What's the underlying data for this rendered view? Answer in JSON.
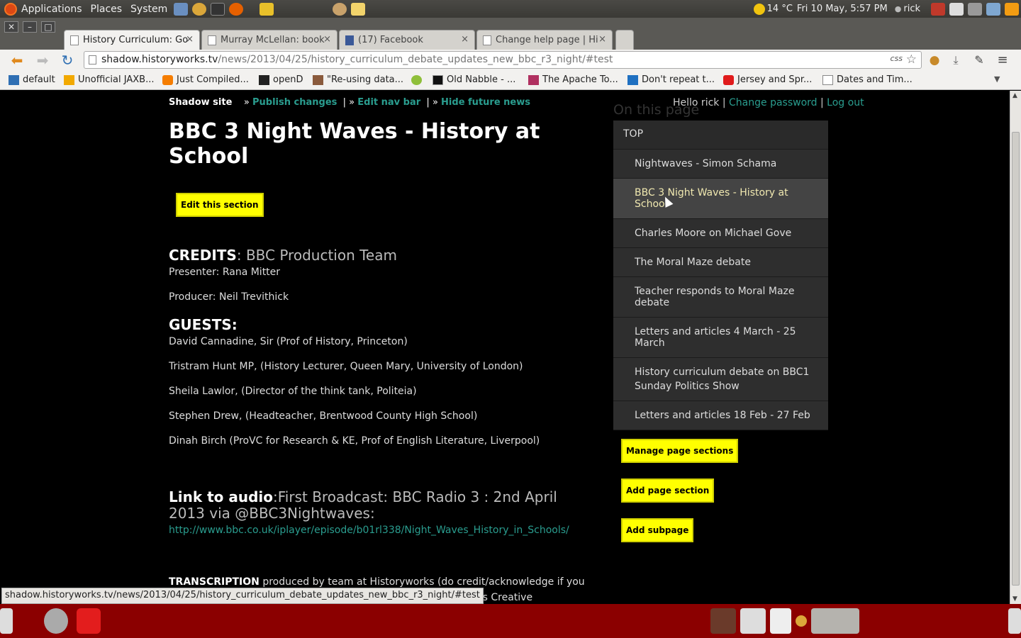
{
  "top_panel": {
    "menus": [
      "Applications",
      "Places",
      "System"
    ],
    "weather": "14 °C",
    "clock": "Fri 10 May,  5:57 PM",
    "user": "rick"
  },
  "tabs": [
    {
      "label": "History Curriculum: Go",
      "active": true
    },
    {
      "label": "Murray McLellan: book",
      "active": false
    },
    {
      "label": "(17) Facebook",
      "active": false
    },
    {
      "label": "Change help page | Hi",
      "active": false
    }
  ],
  "address_bar": {
    "host": "shadow.historyworks.tv",
    "path": "/news/2013/04/25/history_curriculum_debate_updates_new_bbc_r3_night/#test",
    "css_tag": "css"
  },
  "bookmarks": [
    "default",
    "Unofficial JAXB...",
    "Just Compiled...",
    "openD",
    "\"Re-using data...",
    "",
    "Old Nabble - ...",
    "The Apache To...",
    "Don't repeat t...",
    "Jersey and Spr...",
    "Dates and Tim..."
  ],
  "admin_bar": {
    "label": "Shadow site",
    "publish": "Publish changes",
    "edit_nav": "Edit nav bar",
    "hide_future": "Hide future news"
  },
  "user_bar": {
    "hello": "Hello rick",
    "change_password": "Change password",
    "logout": "Log out"
  },
  "main": {
    "title": "BBC 3 Night Waves - History at School",
    "edit_button": "Edit this section",
    "credits_label": "CREDITS",
    "credits_value": ": BBC Production Team",
    "presenter": "Presenter: Rana Mitter",
    "producer": "Producer: Neil Trevithick",
    "guests_label": "GUESTS:",
    "guests": [
      "David Cannadine, Sir (Prof of History, Princeton)",
      "Tristram Hunt MP, (History Lecturer, Queen Mary, University of London)",
      "Sheila Lawlor, (Director of the think tank, Politeia)",
      "Stephen Drew, (Headteacher, Brentwood County High School)",
      "Dinah Birch (ProVC for Research & KE, Prof of English Literature, Liverpool)"
    ],
    "audio_label": "Link to audio",
    "audio_desc": ":First Broadcast: BBC Radio 3 : 2nd April 2013 via @BBC3Nightwaves:",
    "audio_url": "http://www.bbc.co.uk/iplayer/episode/b01rl338/Night_Waves_History_in_Schools/",
    "transcription_label": "TRANSCRIPTION",
    "transcription_text": " produced by team at Historyworks (do credit/acknowledge if you use our transcript: see our policy on our website for copyright is Creative Commons)"
  },
  "sidebar": {
    "heading": "On this page",
    "top": "TOP",
    "items": [
      "Nightwaves - Simon Schama",
      "BBC 3 Night Waves - History at School",
      "Charles Moore on Michael Gove",
      "The Moral Maze debate",
      "Teacher responds to Moral Maze debate",
      "Letters and articles 4 March - 25 March",
      "History curriculum debate on BBC1 Sunday Politics Show",
      "Letters and articles 18 Feb - 27 Feb"
    ],
    "manage_button": "Manage page sections",
    "add_section_button": "Add page section",
    "add_subpage_button": "Add subpage"
  },
  "status_url": "shadow.historyworks.tv/news/2013/04/25/history_curriculum_debate_updates_new_bbc_r3_night/#test"
}
